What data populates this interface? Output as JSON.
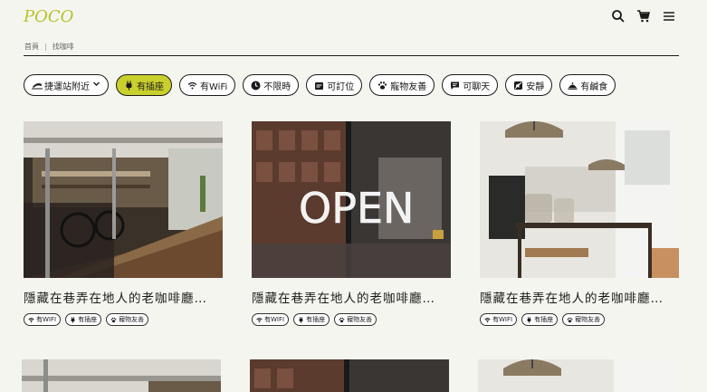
{
  "header": {
    "logo": "POCO",
    "icons": [
      "search-icon",
      "cart-icon",
      "menu-icon"
    ]
  },
  "breadcrumb": {
    "home": "首頁",
    "separator": "|",
    "current": "找咖啡"
  },
  "filters": [
    {
      "icon": "metro-icon",
      "label": "捷運站附近",
      "dropdown": true,
      "active": false
    },
    {
      "icon": "plug-icon",
      "label": "有插座",
      "active": true
    },
    {
      "icon": "wifi-icon",
      "label": "有WiFi",
      "active": false
    },
    {
      "icon": "clock-icon",
      "label": "不限時",
      "active": false
    },
    {
      "icon": "calendar-icon",
      "label": "可訂位",
      "active": false
    },
    {
      "icon": "paw-icon",
      "label": "寵物友善",
      "active": false
    },
    {
      "icon": "chat-icon",
      "label": "可聊天",
      "active": false
    },
    {
      "icon": "mute-icon",
      "label": "安靜",
      "active": false
    },
    {
      "icon": "food-icon",
      "label": "有鹹食",
      "active": false
    }
  ],
  "cards": [
    {
      "title": "隱藏在巷弄在地人的老咖啡廳…",
      "photo": "bar-interior-photo",
      "tags": [
        {
          "icon": "wifi-icon",
          "label": "有WIFI"
        },
        {
          "icon": "plug-icon",
          "label": "有插座"
        },
        {
          "icon": "paw-icon",
          "label": "寵物友善"
        }
      ]
    },
    {
      "title": "隱藏在巷弄在地人的老咖啡廳…",
      "photo": "open-sign-photo",
      "sign_text": "OPEN",
      "tags": [
        {
          "icon": "wifi-icon",
          "label": "有WIFI"
        },
        {
          "icon": "plug-icon",
          "label": "有插座"
        },
        {
          "icon": "paw-icon",
          "label": "寵物友善"
        }
      ]
    },
    {
      "title": "隱藏在巷弄在地人的老咖啡廳…",
      "photo": "cafe-counter-photo",
      "tags": [
        {
          "icon": "wifi-icon",
          "label": "有WIFI"
        },
        {
          "icon": "plug-icon",
          "label": "有插座"
        },
        {
          "icon": "paw-icon",
          "label": "寵物友善"
        }
      ]
    }
  ],
  "colors": {
    "accent": "#c9cf2c",
    "logo": "#b7c22a",
    "background": "#f5f5ef"
  }
}
